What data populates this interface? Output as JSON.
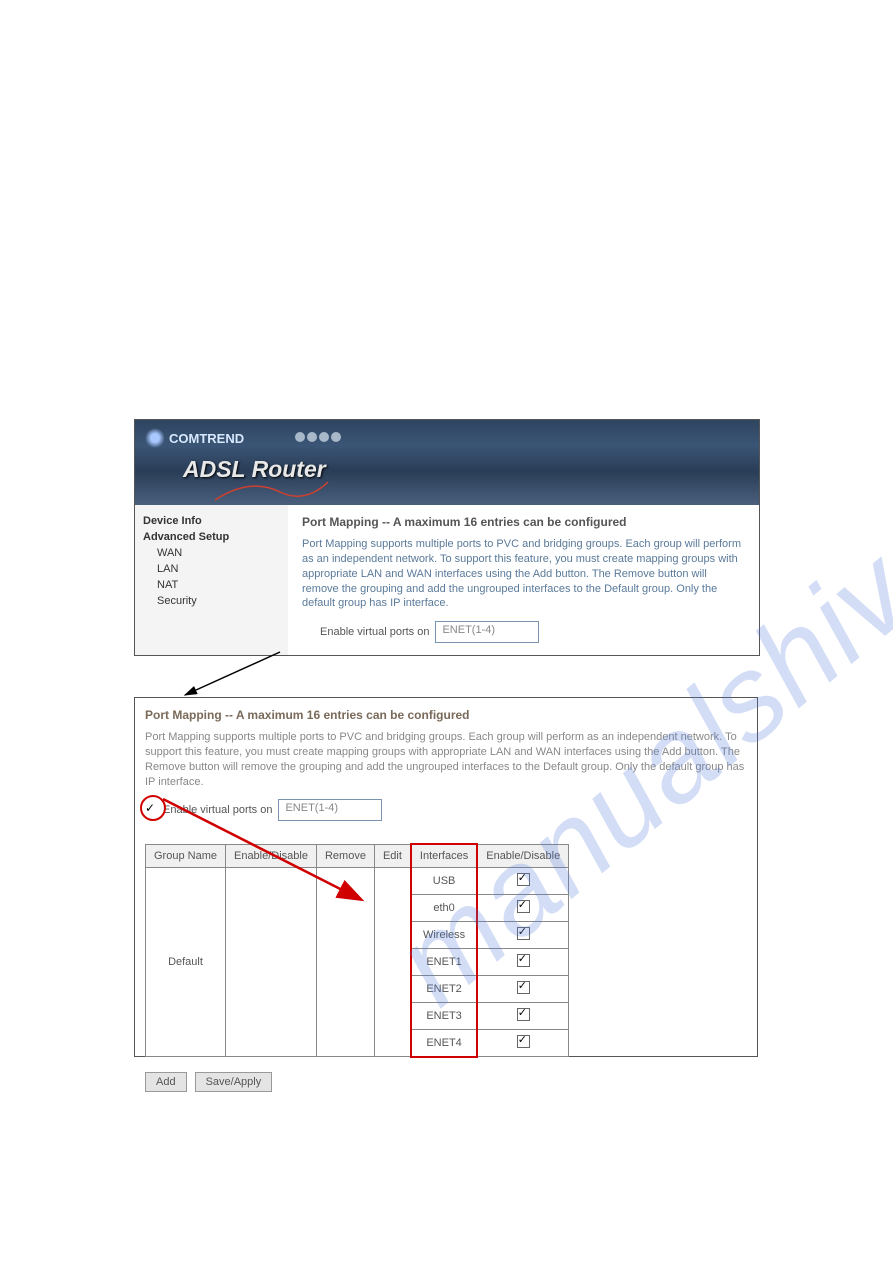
{
  "watermark": "manualshive.com",
  "panel1": {
    "logo_text": "COMTREND",
    "banner_title": "ADSL Router",
    "sidebar": {
      "items": [
        {
          "label": "Device Info",
          "bold": true,
          "sub": false
        },
        {
          "label": "Advanced Setup",
          "bold": true,
          "sub": false
        },
        {
          "label": "WAN",
          "bold": false,
          "sub": true
        },
        {
          "label": "LAN",
          "bold": false,
          "sub": true
        },
        {
          "label": "NAT",
          "bold": false,
          "sub": true
        },
        {
          "label": "Security",
          "bold": false,
          "sub": true
        }
      ]
    },
    "title": "Port Mapping -- A maximum 16 entries can be configured",
    "description": "Port Mapping supports multiple ports to PVC and bridging groups. Each group will perform as an independent network. To support this feature, you must create mapping groups with appropriate LAN and WAN interfaces using the Add button. The Remove button will remove the grouping and add the ungrouped interfaces to the Default group. Only the default group has IP interface.",
    "enable_label": "Enable virtual ports on",
    "enable_value": "ENET(1-4)",
    "enable_checked": false
  },
  "panel2": {
    "title": "Port Mapping -- A maximum 16 entries can be configured",
    "description": "Port Mapping supports multiple ports to PVC and bridging groups. Each group will perform as an independent network. To support this feature, you must create mapping groups with appropriate LAN and WAN interfaces using the Add button. The Remove button will remove the grouping and add the ungrouped interfaces to the Default group. Only the default group has IP interface.",
    "enable_label": "Enable virtual ports on",
    "enable_value": "ENET(1-4)",
    "enable_checked": true,
    "table": {
      "headers": [
        "Group Name",
        "Enable/Disable",
        "Remove",
        "Edit",
        "Interfaces",
        "Enable/Disable"
      ],
      "group_name": "Default",
      "interfaces": [
        "USB",
        "eth0",
        "Wireless",
        "ENET1",
        "ENET2",
        "ENET3",
        "ENET4"
      ]
    },
    "buttons": {
      "add": "Add",
      "save": "Save/Apply"
    }
  }
}
